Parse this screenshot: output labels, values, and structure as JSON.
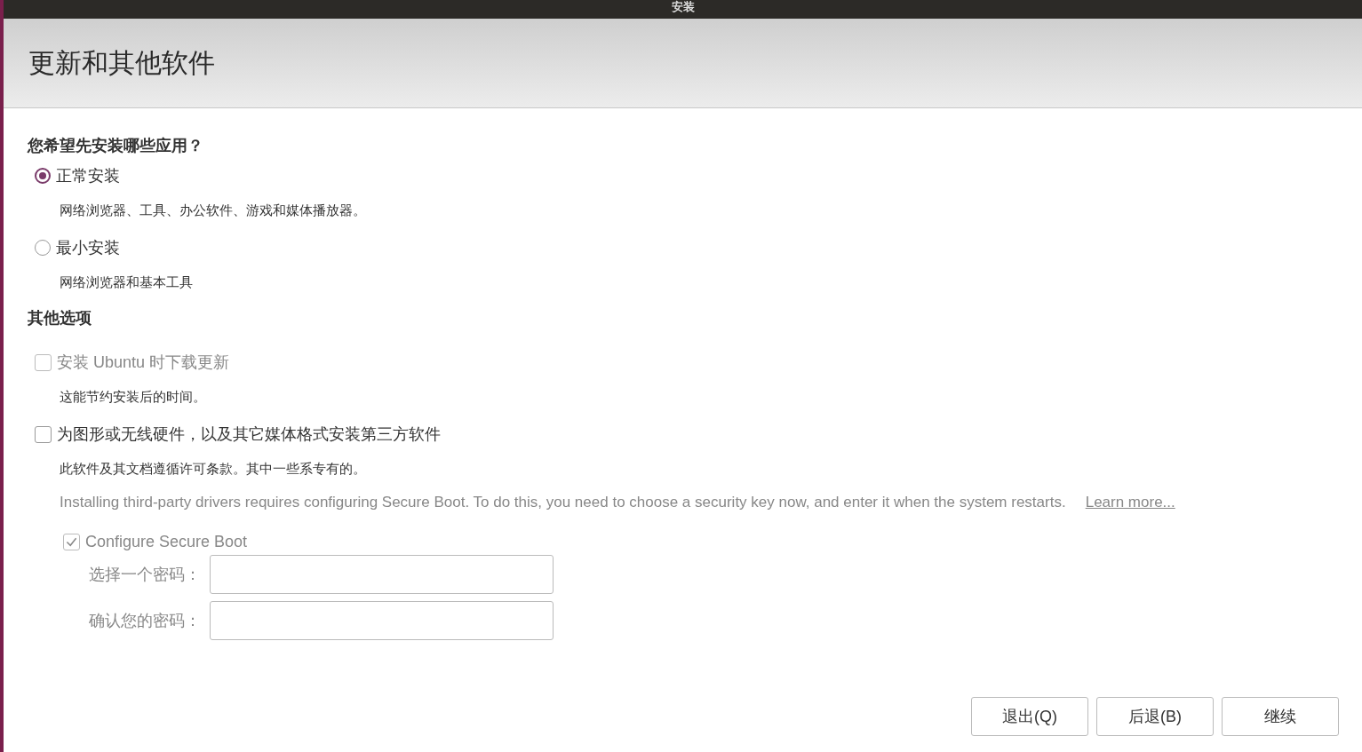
{
  "window": {
    "title": "安装"
  },
  "page_title": "更新和其他软件",
  "install_type": {
    "question": "您希望先安装哪些应用？",
    "options": [
      {
        "label": "正常安装",
        "description": "网络浏览器、工具、办公软件、游戏和媒体播放器。",
        "selected": true
      },
      {
        "label": "最小安装",
        "description": "网络浏览器和基本工具",
        "selected": false
      }
    ]
  },
  "other_options": {
    "heading": "其他选项",
    "options": [
      {
        "label": "安装 Ubuntu 时下载更新",
        "description": "这能节约安装后的时间。",
        "checked": false,
        "disabled": true
      },
      {
        "label": "为图形或无线硬件，以及其它媒体格式安装第三方软件",
        "description": "此软件及其文档遵循许可条款。其中一些系专有的。",
        "checked": false,
        "disabled": false
      }
    ]
  },
  "secure_boot": {
    "disabled": true,
    "notice": "Installing third-party drivers requires configuring Secure Boot. To do this, you need to choose a security key now, and enter it when the system restarts.",
    "link": "Learn more...",
    "checkbox": {
      "label": "Configure Secure Boot",
      "checked": true
    },
    "fields": [
      {
        "label": "选择一个密码："
      },
      {
        "label": "确认您的密码："
      }
    ]
  },
  "buttons": [
    {
      "label": "退出(Q)"
    },
    {
      "label": "后退(B)"
    },
    {
      "label": "继续"
    }
  ]
}
